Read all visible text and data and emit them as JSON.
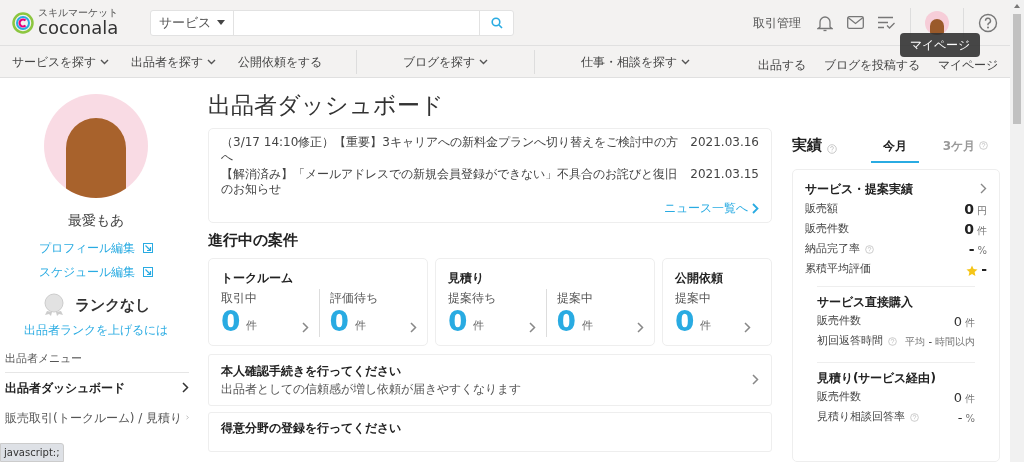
{
  "header": {
    "logo_tagline": "スキルマーケット",
    "logo_name": "coconala",
    "search_category": "サービス",
    "links": [
      "取引管理"
    ],
    "tooltip": "マイページ"
  },
  "nav": {
    "left": [
      {
        "label": "サービスを探す",
        "dropdown": true
      },
      {
        "label": "出品者を探す",
        "dropdown": true
      },
      {
        "label": "公開依頼をする",
        "dropdown": false
      },
      {
        "label": "ブログを探す",
        "dropdown": true
      },
      {
        "label": "仕事・相談を探す",
        "dropdown": true
      }
    ],
    "right": [
      "出品する",
      "ブログを投稿する",
      "マイページ"
    ]
  },
  "profile": {
    "name": "最愛もあ",
    "links": [
      "プロフィール編集",
      "スケジュール編集"
    ],
    "rank": "ランクなし",
    "rank_link": "出品者ランクを上げるには"
  },
  "menu": {
    "heading": "出品者メニュー",
    "items": [
      {
        "label": "出品者ダッシュボード",
        "selected": true
      },
      {
        "label": "販売取引(トークルーム) / 見積り",
        "selected": false
      }
    ]
  },
  "status_bar": "javascript:;",
  "main": {
    "title": "出品者ダッシュボード",
    "news": [
      {
        "text": "（3/17 14:10修正）【重要】3キャリアへの新料金プランへ切り替えをご検討中の方へ",
        "date": "2021.03.16"
      },
      {
        "text": "【解消済み】「メールアドレスでの新規会員登録ができない」不具合のお詫びと復旧のお知らせ",
        "date": "2021.03.15"
      }
    ],
    "news_link": "ニュース一覧へ",
    "section_title": "進行中の案件",
    "project_cards": [
      {
        "title": "トークルーム",
        "stats": [
          {
            "label": "取引中",
            "count": "0",
            "unit": "件"
          },
          {
            "label": "評価待ち",
            "count": "0",
            "unit": "件"
          }
        ]
      },
      {
        "title": "見積り",
        "stats": [
          {
            "label": "提案待ち",
            "count": "0",
            "unit": "件"
          },
          {
            "label": "提案中",
            "count": "0",
            "unit": "件"
          }
        ]
      },
      {
        "title": "公開依頼",
        "stats": [
          {
            "label": "提案中",
            "count": "0",
            "unit": "件"
          }
        ]
      }
    ],
    "tasks": [
      {
        "title": "本人確認手続きを行ってください",
        "description": "出品者としての信頼感が増し依頼が届きやすくなります"
      },
      {
        "title": "得意分野の登録を行ってください"
      }
    ]
  },
  "results": {
    "title": "実績",
    "tabs": [
      {
        "label": "今月",
        "selected": true,
        "help": false
      },
      {
        "label": "3ケ月",
        "selected": false,
        "help": true
      }
    ],
    "card_title": "サービス・提案実績",
    "rows": [
      {
        "kind": "big",
        "label": "販売額",
        "help": false,
        "value": "0",
        "unit": "円"
      },
      {
        "kind": "big",
        "label": "販売件数",
        "help": false,
        "value": "0",
        "unit": "件"
      },
      {
        "kind": "big",
        "label": "納品完了率",
        "help": true,
        "value": "-",
        "unit": "%"
      },
      {
        "kind": "rating",
        "label": "累積平均評価",
        "help": false,
        "value": "-"
      }
    ],
    "subsections": [
      {
        "title": "サービス直接購入",
        "rows": [
          {
            "kind": "small",
            "label": "販売件数",
            "help": false,
            "value": "0",
            "unit": "件"
          },
          {
            "kind": "small",
            "label": "初回返答時間",
            "help": true,
            "prefix": "平均",
            "value": "-",
            "unit": "時間以内"
          }
        ]
      },
      {
        "title": "見積り(サービス経由)",
        "rows": [
          {
            "kind": "small",
            "label": "販売件数",
            "help": false,
            "value": "0",
            "unit": "件"
          },
          {
            "kind": "small",
            "label": "見積り相談回答率",
            "help": true,
            "value": "-",
            "unit": "%"
          }
        ]
      }
    ]
  }
}
